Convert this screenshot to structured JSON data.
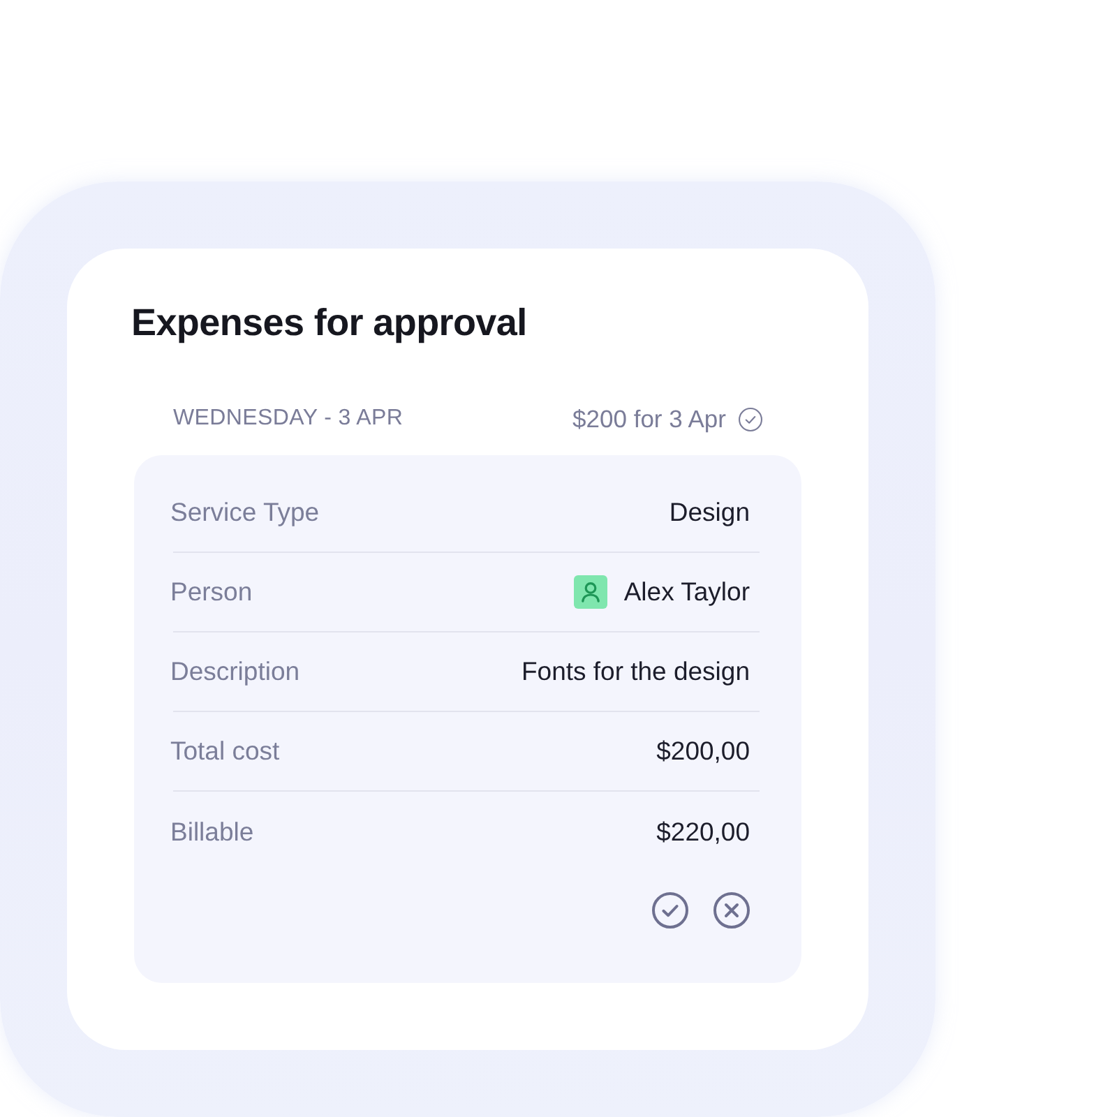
{
  "card": {
    "title": "Expenses for approval"
  },
  "day": {
    "date": "WEDNESDAY - 3 APR",
    "total": "$200 for 3 Apr"
  },
  "details": [
    {
      "kind": "text",
      "label": "Service Type",
      "value": "Design"
    },
    {
      "kind": "person",
      "label": "Person",
      "value": "Alex Taylor"
    },
    {
      "kind": "text",
      "label": "Description",
      "value": "Fonts for the design"
    },
    {
      "kind": "text",
      "label": "Total cost",
      "value": "$200,00"
    },
    {
      "kind": "text",
      "label": "Billable",
      "value": "$220,00"
    }
  ]
}
